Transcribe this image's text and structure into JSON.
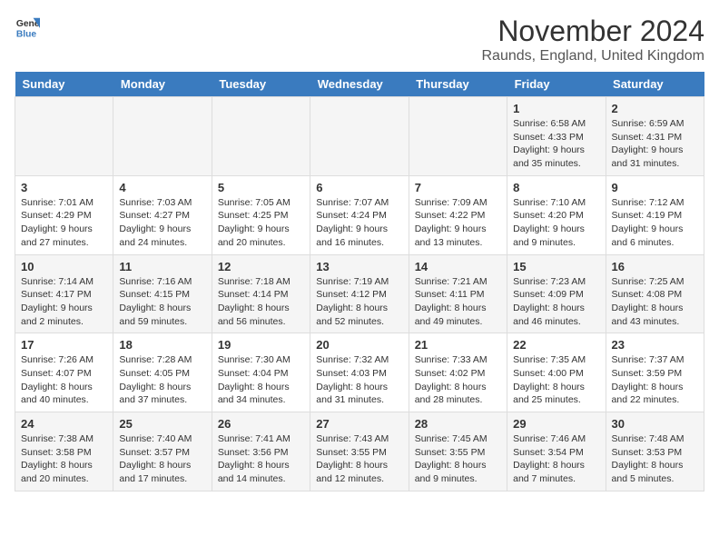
{
  "logo": {
    "general": "General",
    "blue": "Blue"
  },
  "title": {
    "month": "November 2024",
    "location": "Raunds, England, United Kingdom"
  },
  "weekdays": [
    "Sunday",
    "Monday",
    "Tuesday",
    "Wednesday",
    "Thursday",
    "Friday",
    "Saturday"
  ],
  "weeks": [
    [
      {
        "day": "",
        "info": ""
      },
      {
        "day": "",
        "info": ""
      },
      {
        "day": "",
        "info": ""
      },
      {
        "day": "",
        "info": ""
      },
      {
        "day": "",
        "info": ""
      },
      {
        "day": "1",
        "info": "Sunrise: 6:58 AM\nSunset: 4:33 PM\nDaylight: 9 hours and 35 minutes."
      },
      {
        "day": "2",
        "info": "Sunrise: 6:59 AM\nSunset: 4:31 PM\nDaylight: 9 hours and 31 minutes."
      }
    ],
    [
      {
        "day": "3",
        "info": "Sunrise: 7:01 AM\nSunset: 4:29 PM\nDaylight: 9 hours and 27 minutes."
      },
      {
        "day": "4",
        "info": "Sunrise: 7:03 AM\nSunset: 4:27 PM\nDaylight: 9 hours and 24 minutes."
      },
      {
        "day": "5",
        "info": "Sunrise: 7:05 AM\nSunset: 4:25 PM\nDaylight: 9 hours and 20 minutes."
      },
      {
        "day": "6",
        "info": "Sunrise: 7:07 AM\nSunset: 4:24 PM\nDaylight: 9 hours and 16 minutes."
      },
      {
        "day": "7",
        "info": "Sunrise: 7:09 AM\nSunset: 4:22 PM\nDaylight: 9 hours and 13 minutes."
      },
      {
        "day": "8",
        "info": "Sunrise: 7:10 AM\nSunset: 4:20 PM\nDaylight: 9 hours and 9 minutes."
      },
      {
        "day": "9",
        "info": "Sunrise: 7:12 AM\nSunset: 4:19 PM\nDaylight: 9 hours and 6 minutes."
      }
    ],
    [
      {
        "day": "10",
        "info": "Sunrise: 7:14 AM\nSunset: 4:17 PM\nDaylight: 9 hours and 2 minutes."
      },
      {
        "day": "11",
        "info": "Sunrise: 7:16 AM\nSunset: 4:15 PM\nDaylight: 8 hours and 59 minutes."
      },
      {
        "day": "12",
        "info": "Sunrise: 7:18 AM\nSunset: 4:14 PM\nDaylight: 8 hours and 56 minutes."
      },
      {
        "day": "13",
        "info": "Sunrise: 7:19 AM\nSunset: 4:12 PM\nDaylight: 8 hours and 52 minutes."
      },
      {
        "day": "14",
        "info": "Sunrise: 7:21 AM\nSunset: 4:11 PM\nDaylight: 8 hours and 49 minutes."
      },
      {
        "day": "15",
        "info": "Sunrise: 7:23 AM\nSunset: 4:09 PM\nDaylight: 8 hours and 46 minutes."
      },
      {
        "day": "16",
        "info": "Sunrise: 7:25 AM\nSunset: 4:08 PM\nDaylight: 8 hours and 43 minutes."
      }
    ],
    [
      {
        "day": "17",
        "info": "Sunrise: 7:26 AM\nSunset: 4:07 PM\nDaylight: 8 hours and 40 minutes."
      },
      {
        "day": "18",
        "info": "Sunrise: 7:28 AM\nSunset: 4:05 PM\nDaylight: 8 hours and 37 minutes."
      },
      {
        "day": "19",
        "info": "Sunrise: 7:30 AM\nSunset: 4:04 PM\nDaylight: 8 hours and 34 minutes."
      },
      {
        "day": "20",
        "info": "Sunrise: 7:32 AM\nSunset: 4:03 PM\nDaylight: 8 hours and 31 minutes."
      },
      {
        "day": "21",
        "info": "Sunrise: 7:33 AM\nSunset: 4:02 PM\nDaylight: 8 hours and 28 minutes."
      },
      {
        "day": "22",
        "info": "Sunrise: 7:35 AM\nSunset: 4:00 PM\nDaylight: 8 hours and 25 minutes."
      },
      {
        "day": "23",
        "info": "Sunrise: 7:37 AM\nSunset: 3:59 PM\nDaylight: 8 hours and 22 minutes."
      }
    ],
    [
      {
        "day": "24",
        "info": "Sunrise: 7:38 AM\nSunset: 3:58 PM\nDaylight: 8 hours and 20 minutes."
      },
      {
        "day": "25",
        "info": "Sunrise: 7:40 AM\nSunset: 3:57 PM\nDaylight: 8 hours and 17 minutes."
      },
      {
        "day": "26",
        "info": "Sunrise: 7:41 AM\nSunset: 3:56 PM\nDaylight: 8 hours and 14 minutes."
      },
      {
        "day": "27",
        "info": "Sunrise: 7:43 AM\nSunset: 3:55 PM\nDaylight: 8 hours and 12 minutes."
      },
      {
        "day": "28",
        "info": "Sunrise: 7:45 AM\nSunset: 3:55 PM\nDaylight: 8 hours and 9 minutes."
      },
      {
        "day": "29",
        "info": "Sunrise: 7:46 AM\nSunset: 3:54 PM\nDaylight: 8 hours and 7 minutes."
      },
      {
        "day": "30",
        "info": "Sunrise: 7:48 AM\nSunset: 3:53 PM\nDaylight: 8 hours and 5 minutes."
      }
    ]
  ]
}
